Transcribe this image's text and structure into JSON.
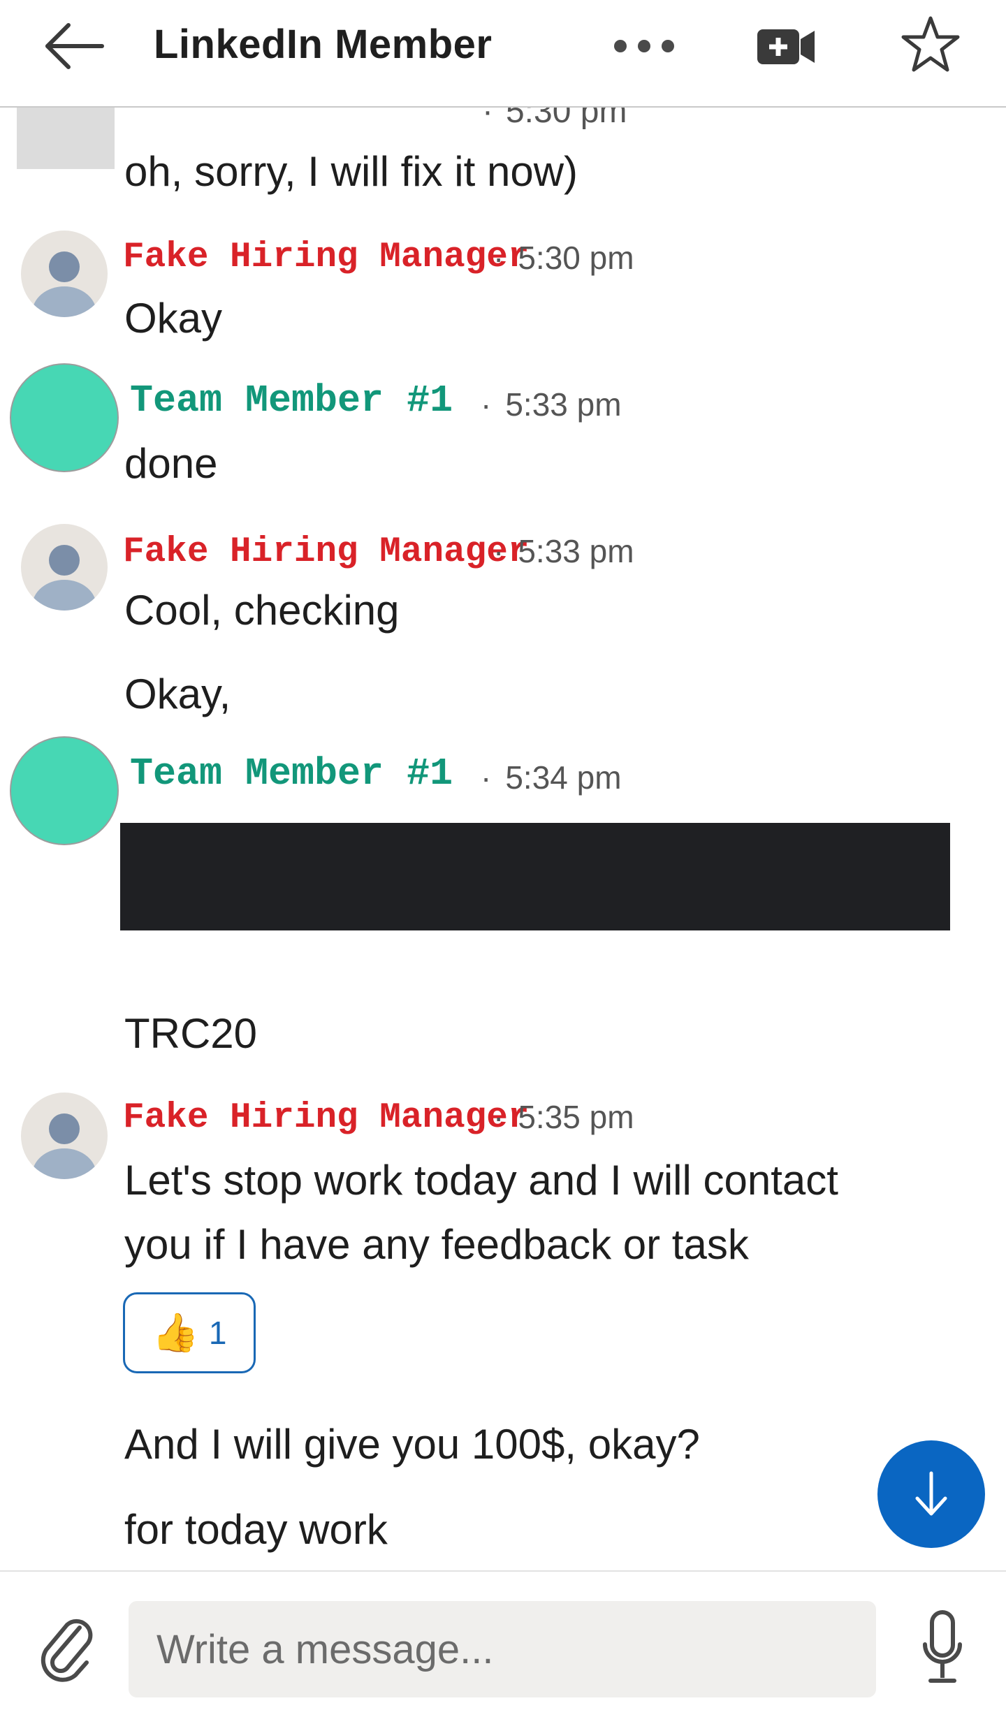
{
  "header": {
    "title": "LinkedIn Member",
    "icons": [
      "back-arrow-icon",
      "more-icon",
      "video-call-icon",
      "star-icon"
    ]
  },
  "messages": {
    "partial_time": "5:30 pm",
    "m1_text": "oh, sorry, I will fix it now)",
    "g1": {
      "sender": "Fake Hiring Manager",
      "time": "5:30 pm",
      "lines": [
        "Okay"
      ]
    },
    "g2": {
      "sender": "Team Member #1",
      "time": "5:33 pm",
      "lines": [
        "done"
      ]
    },
    "g3": {
      "sender": "Fake Hiring Manager",
      "time": "5:33 pm",
      "lines": [
        "Cool, checking",
        "Okay,"
      ]
    },
    "g4": {
      "sender": "Team Member #1",
      "time": "5:34 pm",
      "lines": [
        "TRC20"
      ]
    },
    "g5": {
      "sender": "Fake Hiring Manager",
      "time": "5:35 pm",
      "lines": [
        "Let's stop work today and I will contact",
        "you if I have any feedback or task",
        "And I will give you 100$, okay?",
        "for today work"
      ],
      "reaction": {
        "emoji": "👍",
        "count": "1"
      }
    }
  },
  "composer": {
    "placeholder": "Write a message..."
  },
  "colors": {
    "manager_name": "#d92228",
    "team_name": "#12977a",
    "team_avatar": "#47d7b4",
    "accent": "#0a66c2",
    "redaction": "#1f2023"
  }
}
